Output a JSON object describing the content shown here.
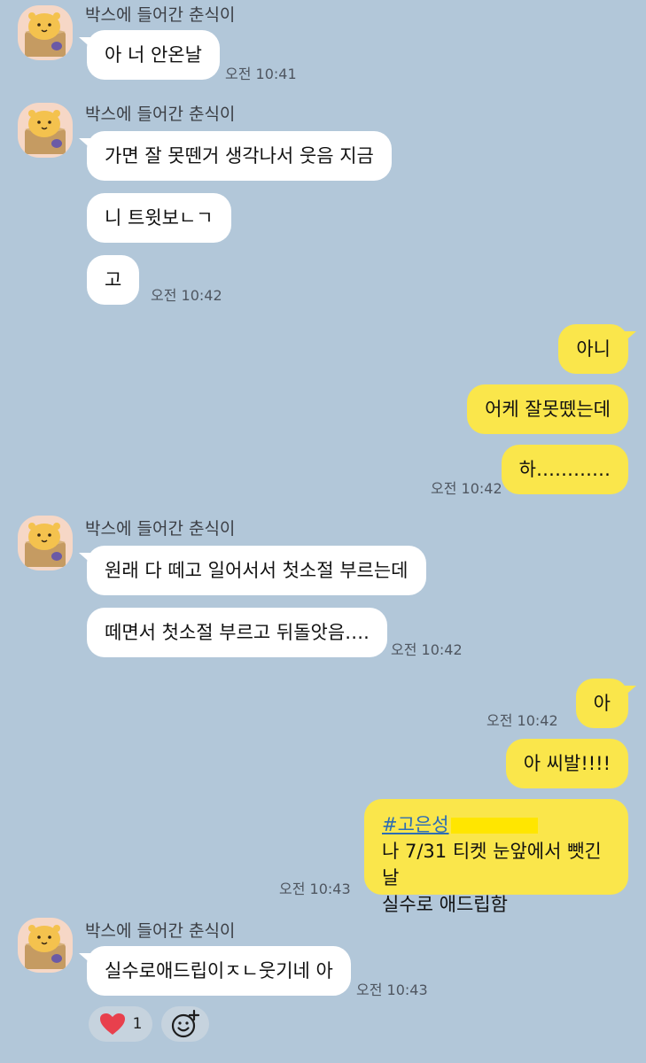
{
  "sender_name": "박스에 들어간 춘식이",
  "groups": [
    {
      "sender": "박스에 들어간 춘식이",
      "messages": [
        "아 너 안온날"
      ],
      "time": "오전 10:41"
    },
    {
      "sender": "박스에 들어간 춘식이",
      "messages": [
        "가면 잘 못뗀거 생각나서 웃음 지금",
        "니 트윗보ㄴㄱ",
        "고"
      ],
      "time": "오전 10:42"
    },
    {
      "me": true,
      "messages": [
        "아니",
        "어케 잘못뗐는데",
        "하…………"
      ],
      "time": "오전 10:42"
    },
    {
      "sender": "박스에 들어간 춘식이",
      "messages": [
        "원래 다 떼고 일어서서 첫소절 부르는데",
        "떼면서 첫소절 부르고 뒤돌앗음…."
      ],
      "time": "오전 10:42"
    },
    {
      "me": true,
      "messages": [
        "아"
      ],
      "time": "오전 10:42"
    },
    {
      "me": true,
      "messages": [
        "아 씨발!!!!"
      ]
    },
    {
      "me": true,
      "hashtag": "#고은성",
      "lines": [
        "나 7/31 티켓 눈앞에서 뺏긴날",
        "실수로 애드립함"
      ],
      "time": "오전 10:43"
    },
    {
      "sender": "박스에 들어간 춘식이",
      "messages": [
        "실수로애드립이ㅈㄴ웃기네 아"
      ],
      "time": "오전 10:43"
    }
  ],
  "reactions": {
    "heart_icon": "heart-icon",
    "heart_count": "1",
    "add_icon": "add-emoji-icon"
  },
  "colors": {
    "background": "#b2c7d9",
    "my_bubble": "#fae64b",
    "their_bubble": "#ffffff",
    "hashtag": "#2d6db3"
  }
}
